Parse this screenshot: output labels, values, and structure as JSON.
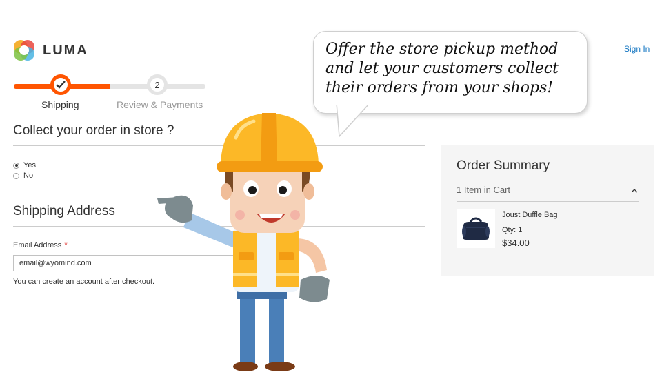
{
  "header": {
    "logo_text": "LUMA",
    "signin_label": "Sign In",
    "logo_icon": "luma-logo-icon"
  },
  "progress": {
    "fraction_complete": 0.5,
    "steps": [
      {
        "label": "Shipping",
        "state": "active",
        "icon": "check-icon"
      },
      {
        "label": "Review & Payments",
        "number": "2",
        "state": "pending"
      }
    ]
  },
  "pickup": {
    "title": "Collect your order in store ?",
    "options": [
      {
        "label": "Yes",
        "selected": true
      },
      {
        "label": "No",
        "selected": false
      }
    ]
  },
  "shipping": {
    "title": "Shipping Address",
    "email_label": "Email Address",
    "required_mark": "*",
    "email_value": "email@wyomind.com",
    "note": "You can create an account after checkout."
  },
  "summary": {
    "title": "Order Summary",
    "cart_count": "1 Item in Cart",
    "item": {
      "name": "Joust Duffle Bag",
      "qty_label": "Qty:",
      "qty": "1",
      "price": "$34.00",
      "image_icon": "duffle-bag-icon"
    }
  },
  "bubble": {
    "lines": [
      "Offer the store pickup method",
      "and let your customers collect",
      "their orders from your shops!"
    ]
  },
  "colors": {
    "accent": "#ff5501",
    "link": "#1979c3",
    "required": "#e02b27",
    "summary_bg": "#f5f5f5",
    "helmet": "#fcb827",
    "vest": "#fcb827"
  }
}
